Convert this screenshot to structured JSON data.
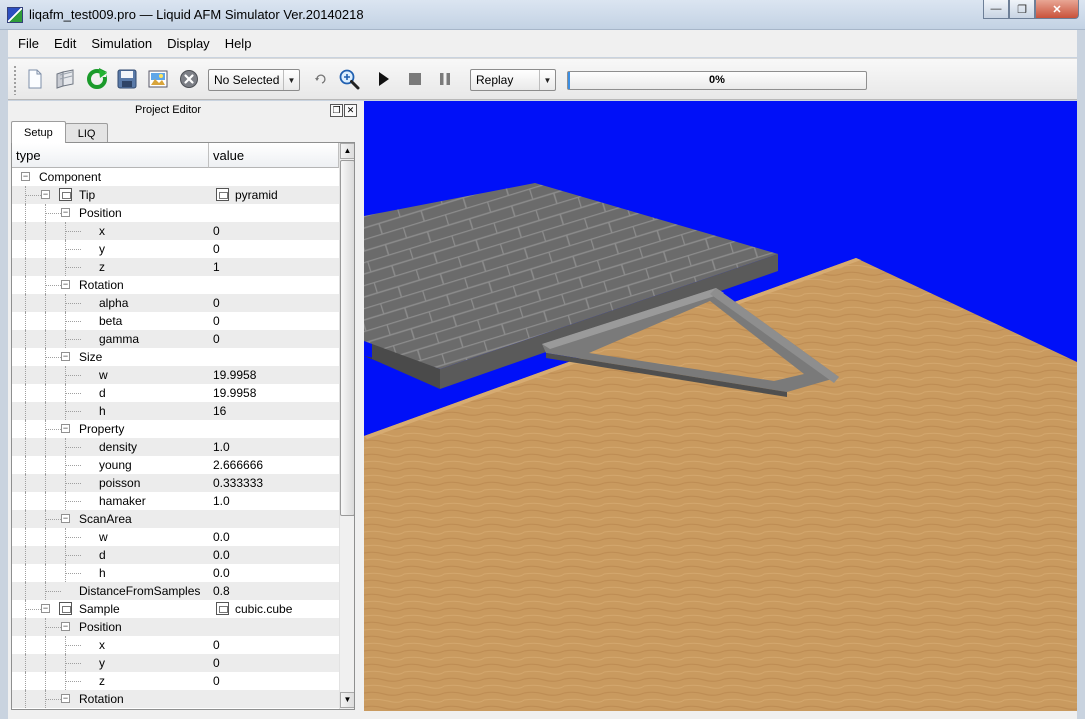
{
  "window": {
    "title": "liqafm_test009.pro — Liquid AFM Simulator Ver.20140218",
    "controls": [
      "—",
      "❐",
      "✕"
    ]
  },
  "menu": [
    "File",
    "Edit",
    "Simulation",
    "Display",
    "Help"
  ],
  "toolbar": {
    "buttons": [
      "new-file-icon",
      "open-folder-icon",
      "reload-icon",
      "save-icon",
      "image-icon",
      "delete-icon"
    ],
    "selection_combo": "No Selected",
    "view_buttons": [
      "reset-view-icon",
      "zoom-icon"
    ],
    "playback_buttons": [
      "play-icon",
      "stop-icon",
      "pause-icon"
    ],
    "mode_combo": "Replay",
    "progress_text": "0%",
    "progress_fraction": 0.0
  },
  "project_editor": {
    "title": "Project Editor",
    "tabs": [
      "Setup",
      "LIQ"
    ],
    "columns": [
      "type",
      "value"
    ],
    "rows": [
      {
        "depth": 0,
        "type": "Component",
        "value": "",
        "expandable": true,
        "icon": false
      },
      {
        "depth": 1,
        "type": "Tip",
        "value": "pyramid",
        "expandable": true,
        "icon": true
      },
      {
        "depth": 2,
        "type": "Position",
        "value": "",
        "expandable": true,
        "icon": false
      },
      {
        "depth": 3,
        "type": "x",
        "value": "0",
        "expandable": false,
        "icon": false
      },
      {
        "depth": 3,
        "type": "y",
        "value": "0",
        "expandable": false,
        "icon": false
      },
      {
        "depth": 3,
        "type": "z",
        "value": "1",
        "expandable": false,
        "icon": false
      },
      {
        "depth": 2,
        "type": "Rotation",
        "value": "",
        "expandable": true,
        "icon": false
      },
      {
        "depth": 3,
        "type": "alpha",
        "value": "0",
        "expandable": false,
        "icon": false
      },
      {
        "depth": 3,
        "type": "beta",
        "value": "0",
        "expandable": false,
        "icon": false
      },
      {
        "depth": 3,
        "type": "gamma",
        "value": "0",
        "expandable": false,
        "icon": false
      },
      {
        "depth": 2,
        "type": "Size",
        "value": "",
        "expandable": true,
        "icon": false
      },
      {
        "depth": 3,
        "type": "w",
        "value": "19.9958",
        "expandable": false,
        "icon": false
      },
      {
        "depth": 3,
        "type": "d",
        "value": "19.9958",
        "expandable": false,
        "icon": false
      },
      {
        "depth": 3,
        "type": "h",
        "value": "16",
        "expandable": false,
        "icon": false
      },
      {
        "depth": 2,
        "type": "Property",
        "value": "",
        "expandable": true,
        "icon": false
      },
      {
        "depth": 3,
        "type": "density",
        "value": "1.0",
        "expandable": false,
        "icon": false
      },
      {
        "depth": 3,
        "type": "young",
        "value": "2.666666",
        "expandable": false,
        "icon": false
      },
      {
        "depth": 3,
        "type": "poisson",
        "value": "0.333333",
        "expandable": false,
        "icon": false
      },
      {
        "depth": 3,
        "type": "hamaker",
        "value": "1.0",
        "expandable": false,
        "icon": false
      },
      {
        "depth": 2,
        "type": "ScanArea",
        "value": "",
        "expandable": true,
        "icon": false
      },
      {
        "depth": 3,
        "type": "w",
        "value": "0.0",
        "expandable": false,
        "icon": false
      },
      {
        "depth": 3,
        "type": "d",
        "value": "0.0",
        "expandable": false,
        "icon": false
      },
      {
        "depth": 3,
        "type": "h",
        "value": "0.0",
        "expandable": false,
        "icon": false
      },
      {
        "depth": 2,
        "type": "DistanceFromSamples",
        "value": "0.8",
        "expandable": false,
        "icon": false
      },
      {
        "depth": 1,
        "type": "Sample",
        "value": "cubic.cube",
        "expandable": true,
        "icon": true
      },
      {
        "depth": 2,
        "type": "Position",
        "value": "",
        "expandable": true,
        "icon": false
      },
      {
        "depth": 3,
        "type": "x",
        "value": "0",
        "expandable": false,
        "icon": false
      },
      {
        "depth": 3,
        "type": "y",
        "value": "0",
        "expandable": false,
        "icon": false
      },
      {
        "depth": 3,
        "type": "z",
        "value": "0",
        "expandable": false,
        "icon": false
      },
      {
        "depth": 2,
        "type": "Rotation",
        "value": "",
        "expandable": true,
        "icon": false
      }
    ]
  },
  "viewport": {
    "background": "#0010f8",
    "sand_color": "#c99a5f",
    "tile_color": "#6b6b6b"
  }
}
